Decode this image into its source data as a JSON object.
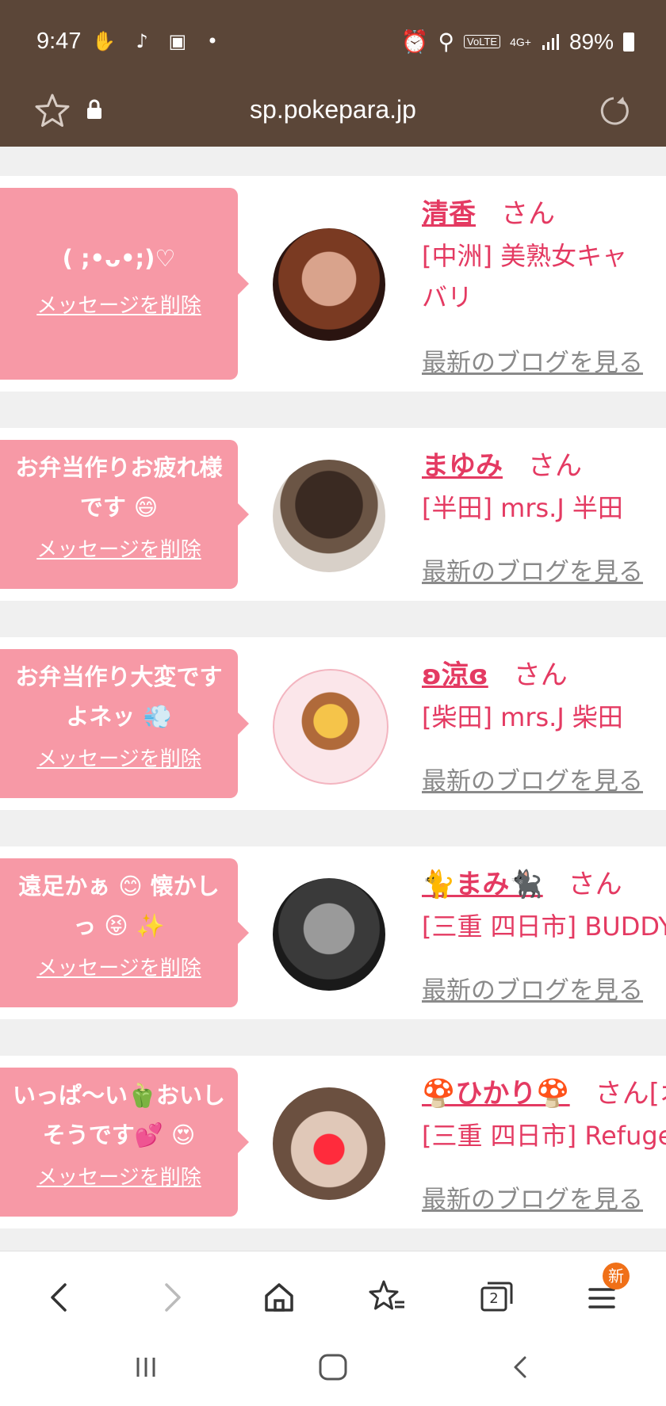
{
  "status_bar": {
    "time": "9:47",
    "signal_label": "4G+",
    "volte_label": "VoLTE",
    "battery": "89%"
  },
  "browser": {
    "url": "sp.pokepara.jp"
  },
  "cards": [
    {
      "message": "( ;•ᴗ•;)♡",
      "delete_label": "メッセージを削除",
      "name": "清香",
      "suffix": "さん",
      "shop": "[中洲] 美熟女キャバリ",
      "blog_label": "最新のブログを見る"
    },
    {
      "message": "お弁当作りお疲れ様です 😄",
      "delete_label": "メッセージを削除",
      "name": "まゆみ",
      "suffix": "さん",
      "shop": "[半田] mrs.J 半田",
      "blog_label": "最新のブログを見る"
    },
    {
      "message": "お弁当作り大変ですよネッ 💨",
      "delete_label": "メッセージを削除",
      "name": "ʚ涼ɞ",
      "suffix": "さん",
      "shop": "[柴田] mrs.J 柴田",
      "blog_label": "最新のブログを見る"
    },
    {
      "message": "遠足かぁ 😊 懐かしっ 😝 ✨",
      "delete_label": "メッセージを削除",
      "name": "🐈まみ🐈‍⬛",
      "suffix": "さん",
      "shop": "[三重 四日市] BUDDY",
      "blog_label": "最新のブログを見る"
    },
    {
      "message": "いっぱ〜い🫑おいしそうです💕 😍",
      "delete_label": "メッセージを削除",
      "name": "🍄ひかり🍄",
      "suffix": "さん[オ",
      "shop": "[三重 四日市] Refuge",
      "blog_label": "最新のブログを見る"
    }
  ],
  "bottom_nav": {
    "tabs_count": "2",
    "menu_badge": "新"
  },
  "colors": {
    "status_bar": "#5b4638",
    "bubble": "#f799a6",
    "accent": "#e43a62"
  }
}
